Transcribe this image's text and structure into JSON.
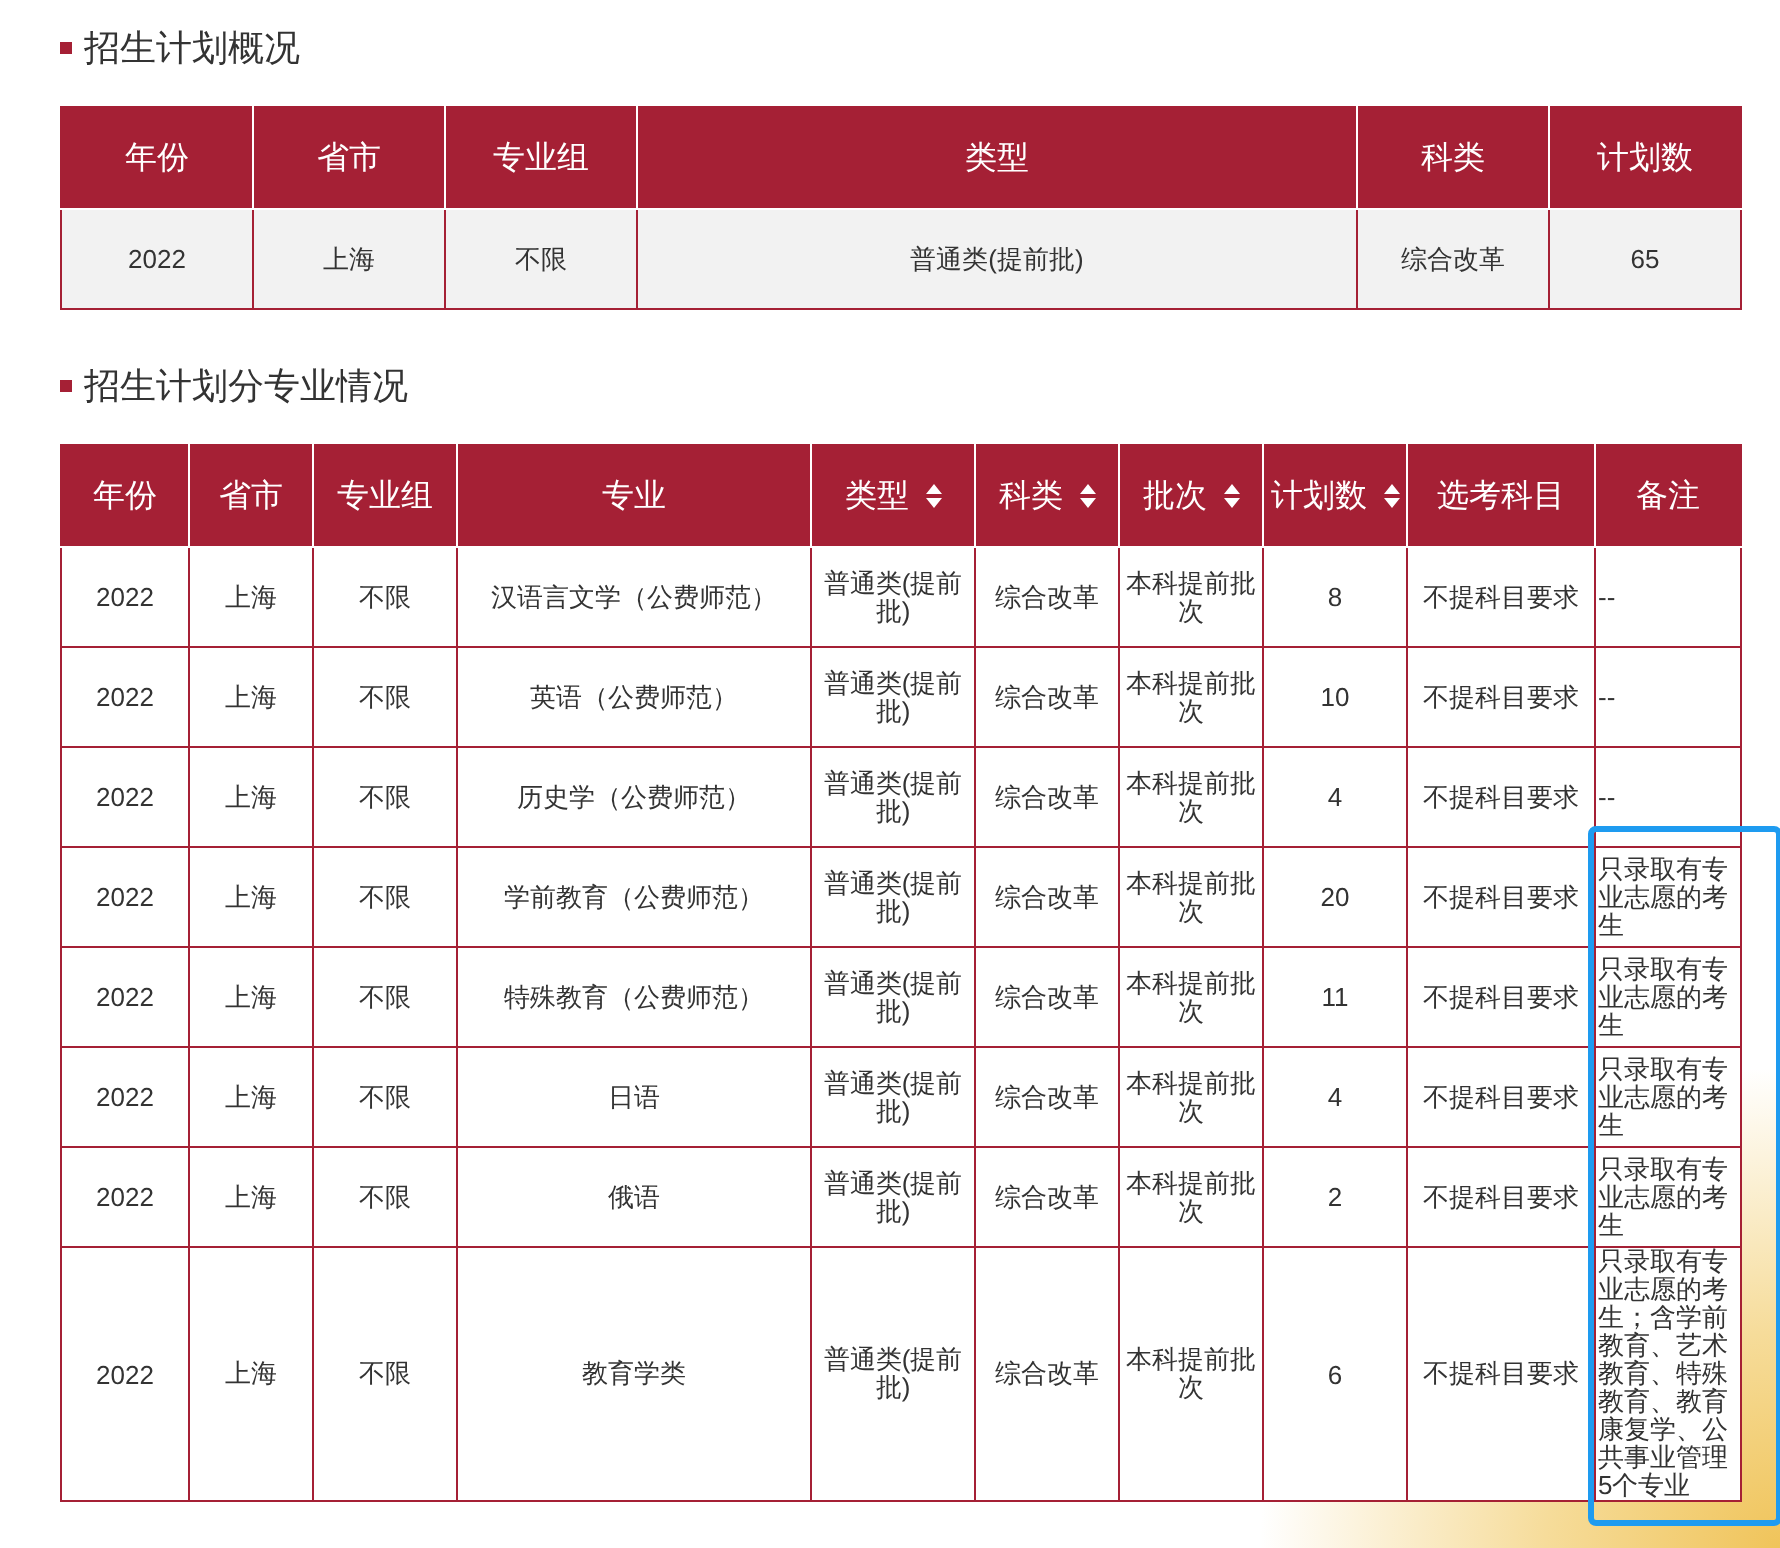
{
  "overview": {
    "title": "招生计划概况",
    "columns": [
      "年份",
      "省市",
      "专业组",
      "类型",
      "科类",
      "计划数"
    ],
    "rows": [
      [
        "2022",
        "上海",
        "不限",
        "普通类(提前批)",
        "综合改革",
        "65"
      ]
    ]
  },
  "majors": {
    "title": "招生计划分专业情况",
    "columns": [
      {
        "label": "年份",
        "sortable": false
      },
      {
        "label": "省市",
        "sortable": false
      },
      {
        "label": "专业组",
        "sortable": false
      },
      {
        "label": "专业",
        "sortable": false
      },
      {
        "label": "类型",
        "sortable": true
      },
      {
        "label": "科类",
        "sortable": true
      },
      {
        "label": "批次",
        "sortable": true
      },
      {
        "label": "计划数",
        "sortable": true
      },
      {
        "label": "选考科目",
        "sortable": false
      },
      {
        "label": "备注",
        "sortable": false
      }
    ],
    "rows": [
      [
        "2022",
        "上海",
        "不限",
        "汉语言文学（公费师范）",
        "普通类(提前批)",
        "综合改革",
        "本科提前批次",
        "8",
        "不提科目要求",
        "--"
      ],
      [
        "2022",
        "上海",
        "不限",
        "英语（公费师范）",
        "普通类(提前批)",
        "综合改革",
        "本科提前批次",
        "10",
        "不提科目要求",
        "--"
      ],
      [
        "2022",
        "上海",
        "不限",
        "历史学（公费师范）",
        "普通类(提前批)",
        "综合改革",
        "本科提前批次",
        "4",
        "不提科目要求",
        "--"
      ],
      [
        "2022",
        "上海",
        "不限",
        "学前教育（公费师范）",
        "普通类(提前批)",
        "综合改革",
        "本科提前批次",
        "20",
        "不提科目要求",
        "只录取有专业志愿的考生"
      ],
      [
        "2022",
        "上海",
        "不限",
        "特殊教育（公费师范）",
        "普通类(提前批)",
        "综合改革",
        "本科提前批次",
        "11",
        "不提科目要求",
        "只录取有专业志愿的考生"
      ],
      [
        "2022",
        "上海",
        "不限",
        "日语",
        "普通类(提前批)",
        "综合改革",
        "本科提前批次",
        "4",
        "不提科目要求",
        "只录取有专业志愿的考生"
      ],
      [
        "2022",
        "上海",
        "不限",
        "俄语",
        "普通类(提前批)",
        "综合改革",
        "本科提前批次",
        "2",
        "不提科目要求",
        "只录取有专业志愿的考生"
      ],
      [
        "2022",
        "上海",
        "不限",
        "教育学类",
        "普通类(提前批)",
        "综合改革",
        "本科提前批次",
        "6",
        "不提科目要求",
        "只录取有专业志愿的考生；含学前教育、艺术教育、特殊教育、教育康复学、公共事业管理5个专业"
      ]
    ]
  }
}
